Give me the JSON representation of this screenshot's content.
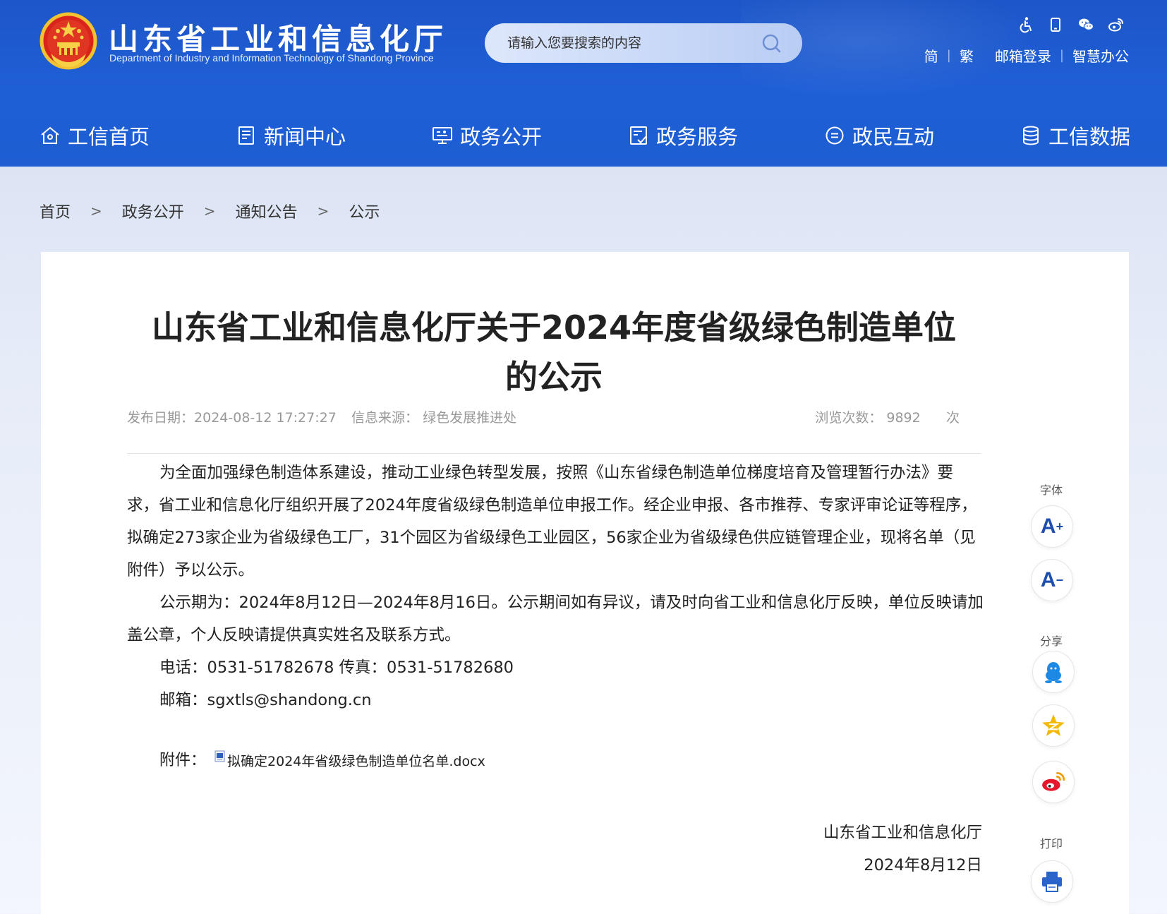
{
  "site": {
    "title": "山东省工业和信息化厅",
    "subtitle": "Department of Industry and Information Technology of Shandong Province"
  },
  "search": {
    "placeholder": "请输入您要搜索的内容"
  },
  "utility": {
    "icons": [
      "accessibility-icon",
      "mobile-icon",
      "wechat-icon",
      "weibo-icon"
    ],
    "links": [
      "简",
      "繁",
      "邮箱登录",
      "智慧办公"
    ]
  },
  "nav": [
    {
      "label": "工信首页",
      "icon": "home-icon"
    },
    {
      "label": "新闻中心",
      "icon": "news-icon"
    },
    {
      "label": "政务公开",
      "icon": "monitor-icon"
    },
    {
      "label": "政务服务",
      "icon": "service-icon"
    },
    {
      "label": "政民互动",
      "icon": "chat-icon"
    },
    {
      "label": "工信数据",
      "icon": "database-icon"
    }
  ],
  "breadcrumb": [
    "首页",
    "政务公开",
    "通知公告",
    "公示"
  ],
  "breadcrumb_sep": ">",
  "article": {
    "title_line1": "山东省工业和信息化厅关于2024年度省级绿色制造单位",
    "title_line2": "的公示",
    "date_label": "发布日期：",
    "date": "2024-08-12 17:27:27",
    "source_label": "信息来源：",
    "source": "绿色发展推进处",
    "views_label": "浏览次数：",
    "views": "9892",
    "views_unit": "次",
    "paragraphs": [
      "为全面加强绿色制造体系建设，推动工业绿色转型发展，按照《山东省绿色制造单位梯度培育及管理暂行办法》要求，省工业和信息化厅组织开展了2024年度省级绿色制造单位申报工作。经企业申报、各市推荐、专家评审论证等程序，拟确定273家企业为省级绿色工厂，31个园区为省级绿色工业园区，56家企业为省级绿色供应链管理企业，现将名单（见附件）予以公示。",
      "公示期为：2024年8月12日—2024年8月16日。公示期间如有异议，请及时向省工业和信息化厅反映，单位反映请加盖公章，个人反映请提供真实姓名及联系方式。",
      "电话：0531-51782678 传真：0531-51782680",
      "邮箱：sgxtls@shandong.cn"
    ],
    "attachment_label": "附件：",
    "attachment_name": "拟确定2024年省级绿色制造单位名单.docx",
    "signature_org": "山东省工业和信息化厅",
    "signature_date": "2024年8月12日"
  },
  "toolbar": {
    "font_label": "字体",
    "font_increase": "A",
    "font_decrease": "A",
    "share_label": "分享",
    "print_label": "打印"
  },
  "colors": {
    "header_blue": "#1f5fd6",
    "nav_text": "#ffffff",
    "accent_icon": "#1f4fae"
  }
}
